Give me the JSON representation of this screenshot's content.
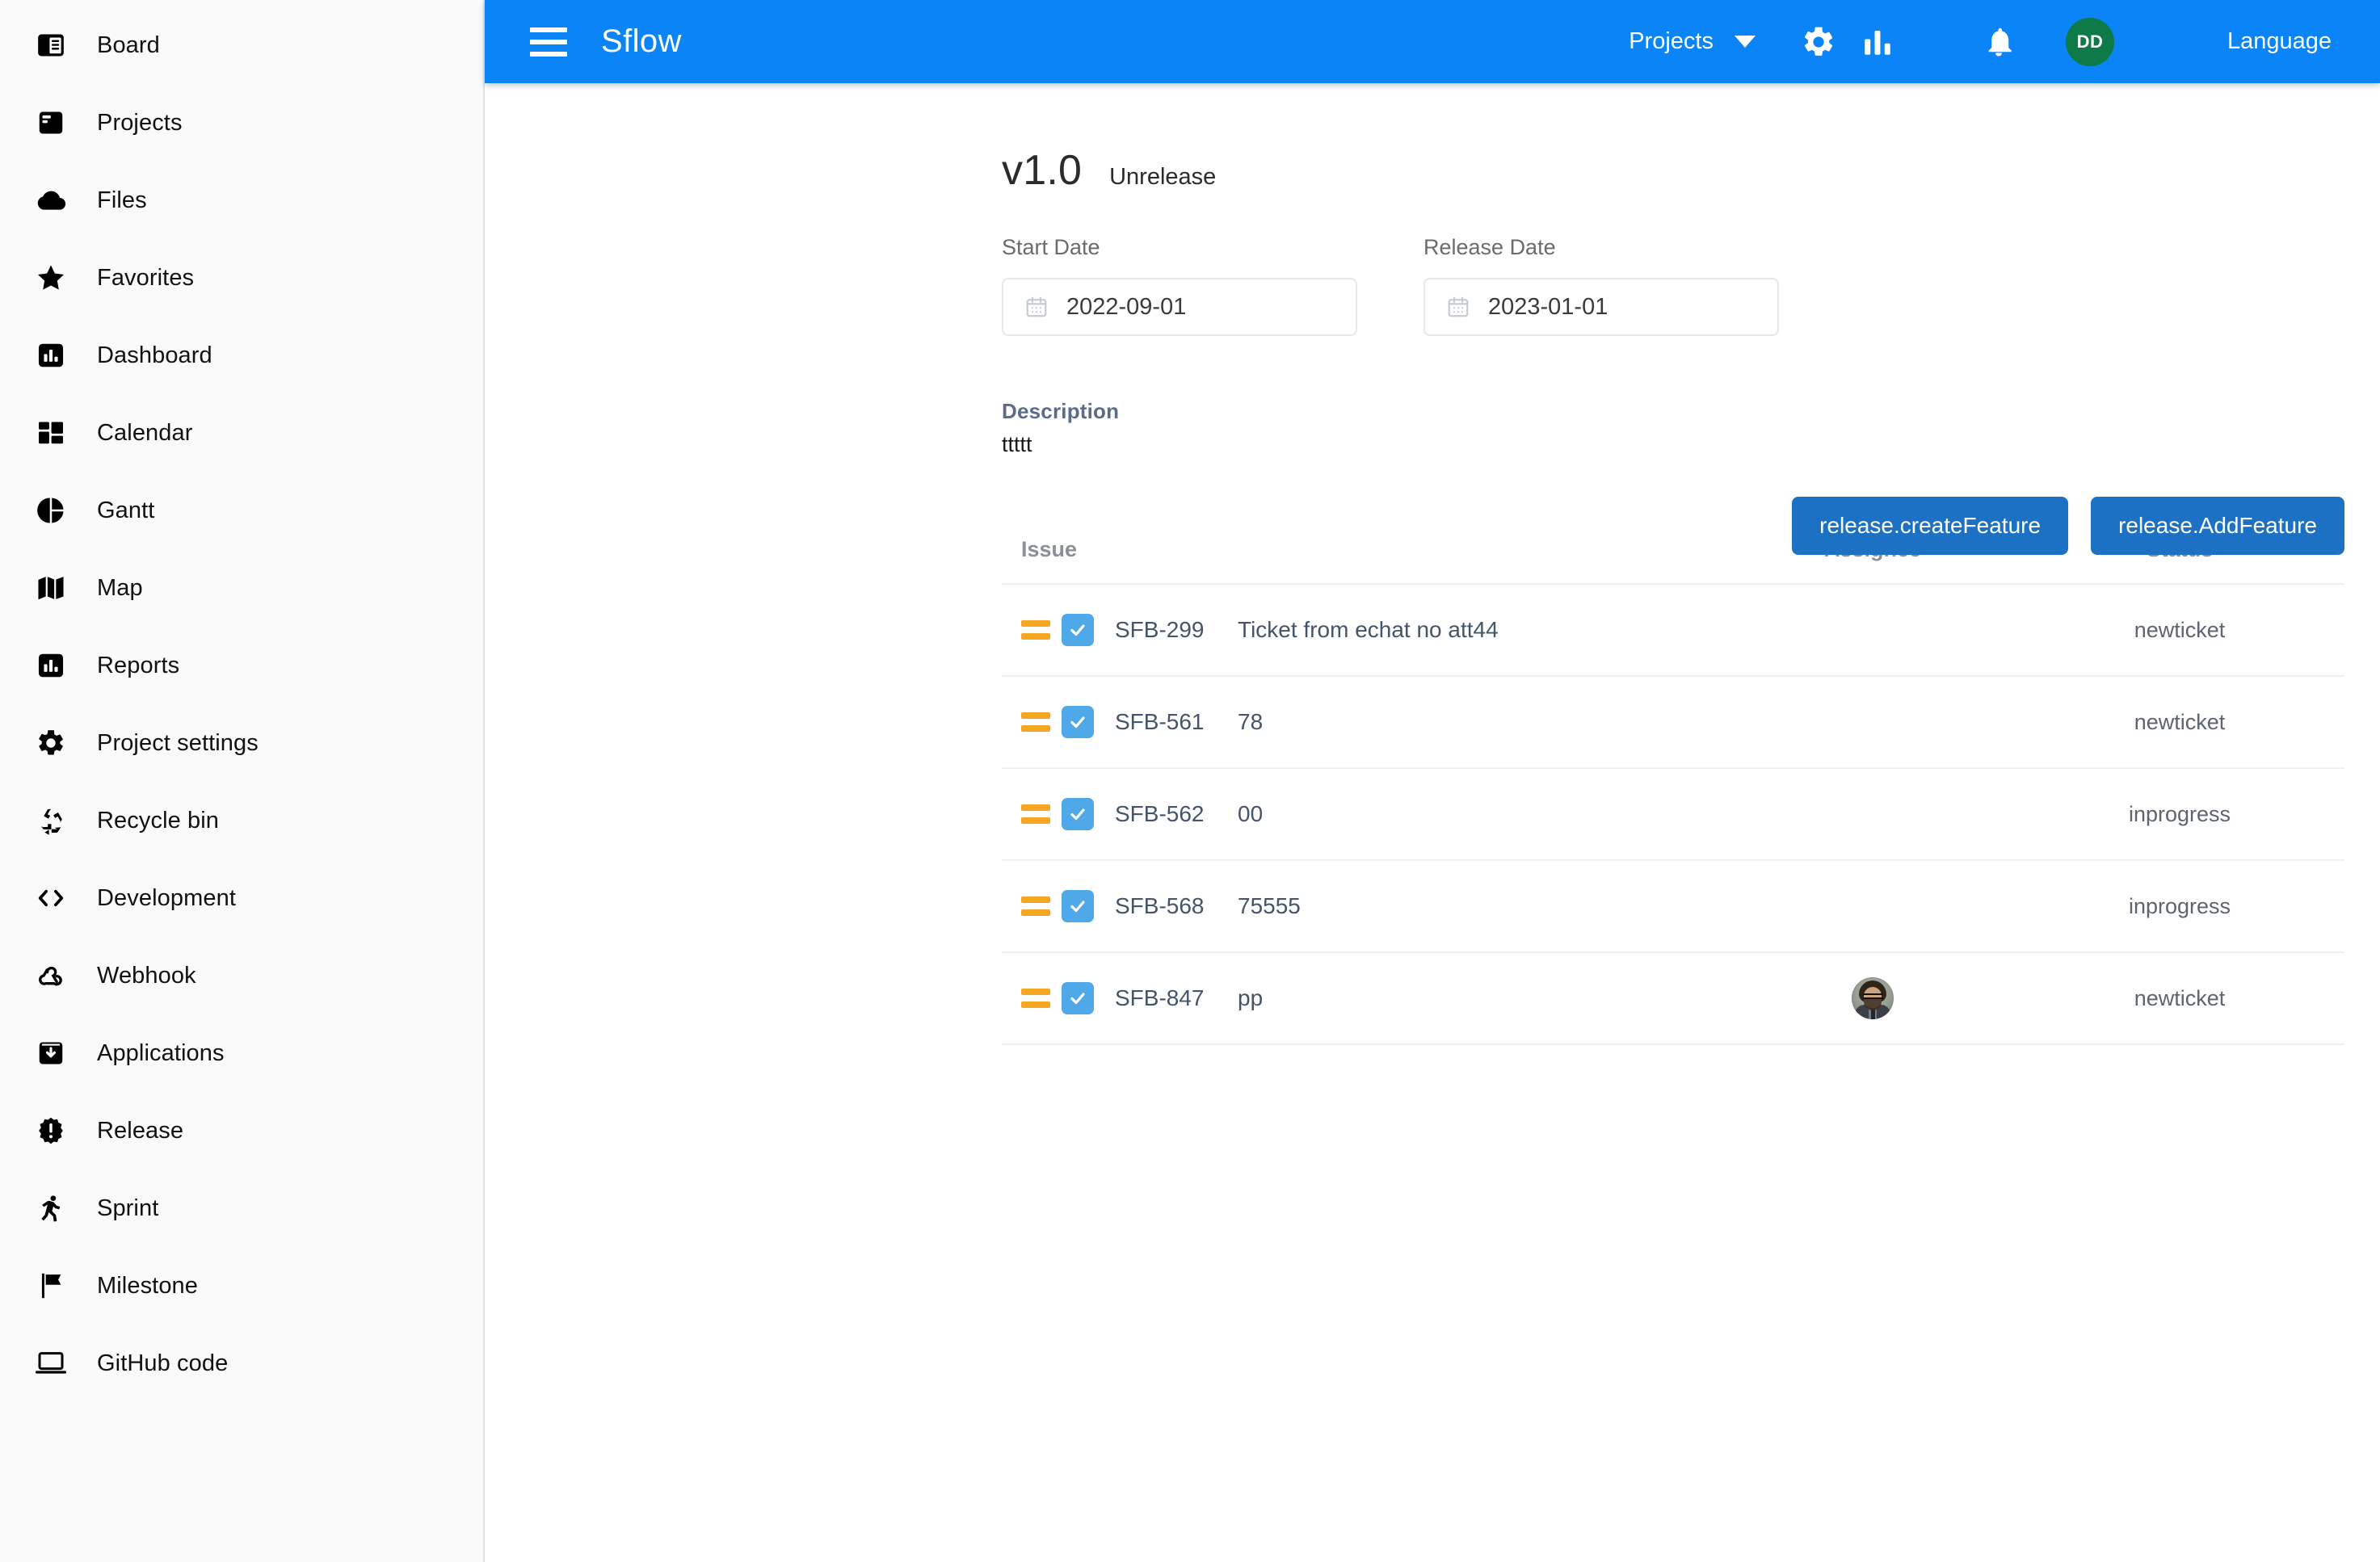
{
  "sidebar": {
    "items": [
      {
        "label": "Board",
        "icon": "board-icon"
      },
      {
        "label": "Projects",
        "icon": "projects-icon"
      },
      {
        "label": "Files",
        "icon": "cloud-icon"
      },
      {
        "label": "Favorites",
        "icon": "star-icon"
      },
      {
        "label": "Dashboard",
        "icon": "bar-chart-icon"
      },
      {
        "label": "Calendar",
        "icon": "grid-icon"
      },
      {
        "label": "Gantt",
        "icon": "pie-chart-icon"
      },
      {
        "label": "Map",
        "icon": "map-icon"
      },
      {
        "label": "Reports",
        "icon": "bar-chart-icon"
      },
      {
        "label": "Project settings",
        "icon": "gear-icon"
      },
      {
        "label": "Recycle bin",
        "icon": "recycle-icon"
      },
      {
        "label": "Development",
        "icon": "code-brackets-icon"
      },
      {
        "label": "Webhook",
        "icon": "webhook-icon"
      },
      {
        "label": "Applications",
        "icon": "download-box-icon"
      },
      {
        "label": "Release",
        "icon": "release-badge-icon"
      },
      {
        "label": "Sprint",
        "icon": "runner-icon"
      },
      {
        "label": "Milestone",
        "icon": "flag-icon"
      },
      {
        "label": "GitHub code",
        "icon": "laptop-icon"
      }
    ]
  },
  "topbar": {
    "menu_icon": "hamburger-icon",
    "brand": "Sflow",
    "projects_label": "Projects",
    "projects_caret": "chevron-down-icon",
    "gear_icon": "gear-icon",
    "chart_icon": "bar-chart-icon",
    "bell_icon": "bell-icon",
    "avatar_initials": "DD",
    "language_label": "Language",
    "bg_color": "#0a84f7",
    "avatar_color": "#0d7a47"
  },
  "release": {
    "version": "v1.0",
    "state": "Unrelease",
    "start_date_label": "Start Date",
    "start_date_value": "2022-09-01",
    "release_date_label": "Release Date",
    "release_date_value": "2023-01-01",
    "calendar_icon": "calendar-icon",
    "description_label": "Description",
    "description_value": "ttttt",
    "create_feature_label": "release.createFeature",
    "add_feature_label": "release.AddFeature",
    "button_color": "#1c71c4"
  },
  "table": {
    "columns": {
      "issue": "Issue",
      "assignee": "Assignee",
      "status": "Status"
    },
    "rows": [
      {
        "priority": "medium",
        "type": "task",
        "key": "SFB-299",
        "summary": "Ticket from echat no att44",
        "assignee": "",
        "status": "newticket"
      },
      {
        "priority": "medium",
        "type": "task",
        "key": "SFB-561",
        "summary": "78",
        "assignee": "",
        "status": "newticket"
      },
      {
        "priority": "medium",
        "type": "task",
        "key": "SFB-562",
        "summary": "00",
        "assignee": "",
        "status": "inprogress"
      },
      {
        "priority": "medium",
        "type": "task",
        "key": "SFB-568",
        "summary": "75555",
        "assignee": "",
        "status": "inprogress"
      },
      {
        "priority": "medium",
        "type": "task",
        "key": "SFB-847",
        "summary": "pp",
        "assignee": "photo",
        "status": "newticket"
      }
    ],
    "priority_color": "#f6a623",
    "task_color": "#4fa8e8"
  }
}
